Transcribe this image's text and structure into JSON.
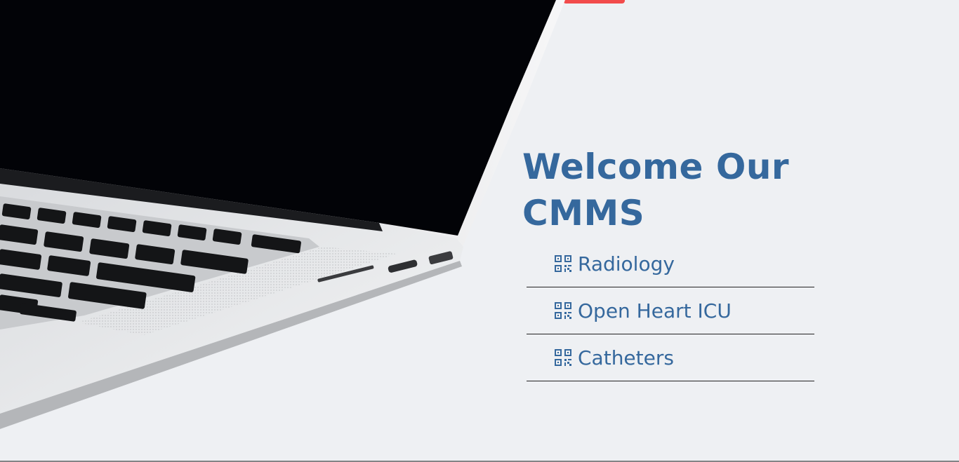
{
  "window": {
    "title": "CMMS"
  },
  "header": {
    "title": "Welcome Our CMMS"
  },
  "menu": {
    "items": [
      {
        "label": "Radiology",
        "icon": "qrcode-icon"
      },
      {
        "label": "Open Heart ICU",
        "icon": "qrcode-icon"
      },
      {
        "label": "Catheters",
        "icon": "qrcode-icon"
      }
    ]
  },
  "colors": {
    "accent": "#35689d",
    "background": "#eef0f3",
    "indicator_green": "#35b522",
    "indicator_red": "#f24b4b"
  }
}
